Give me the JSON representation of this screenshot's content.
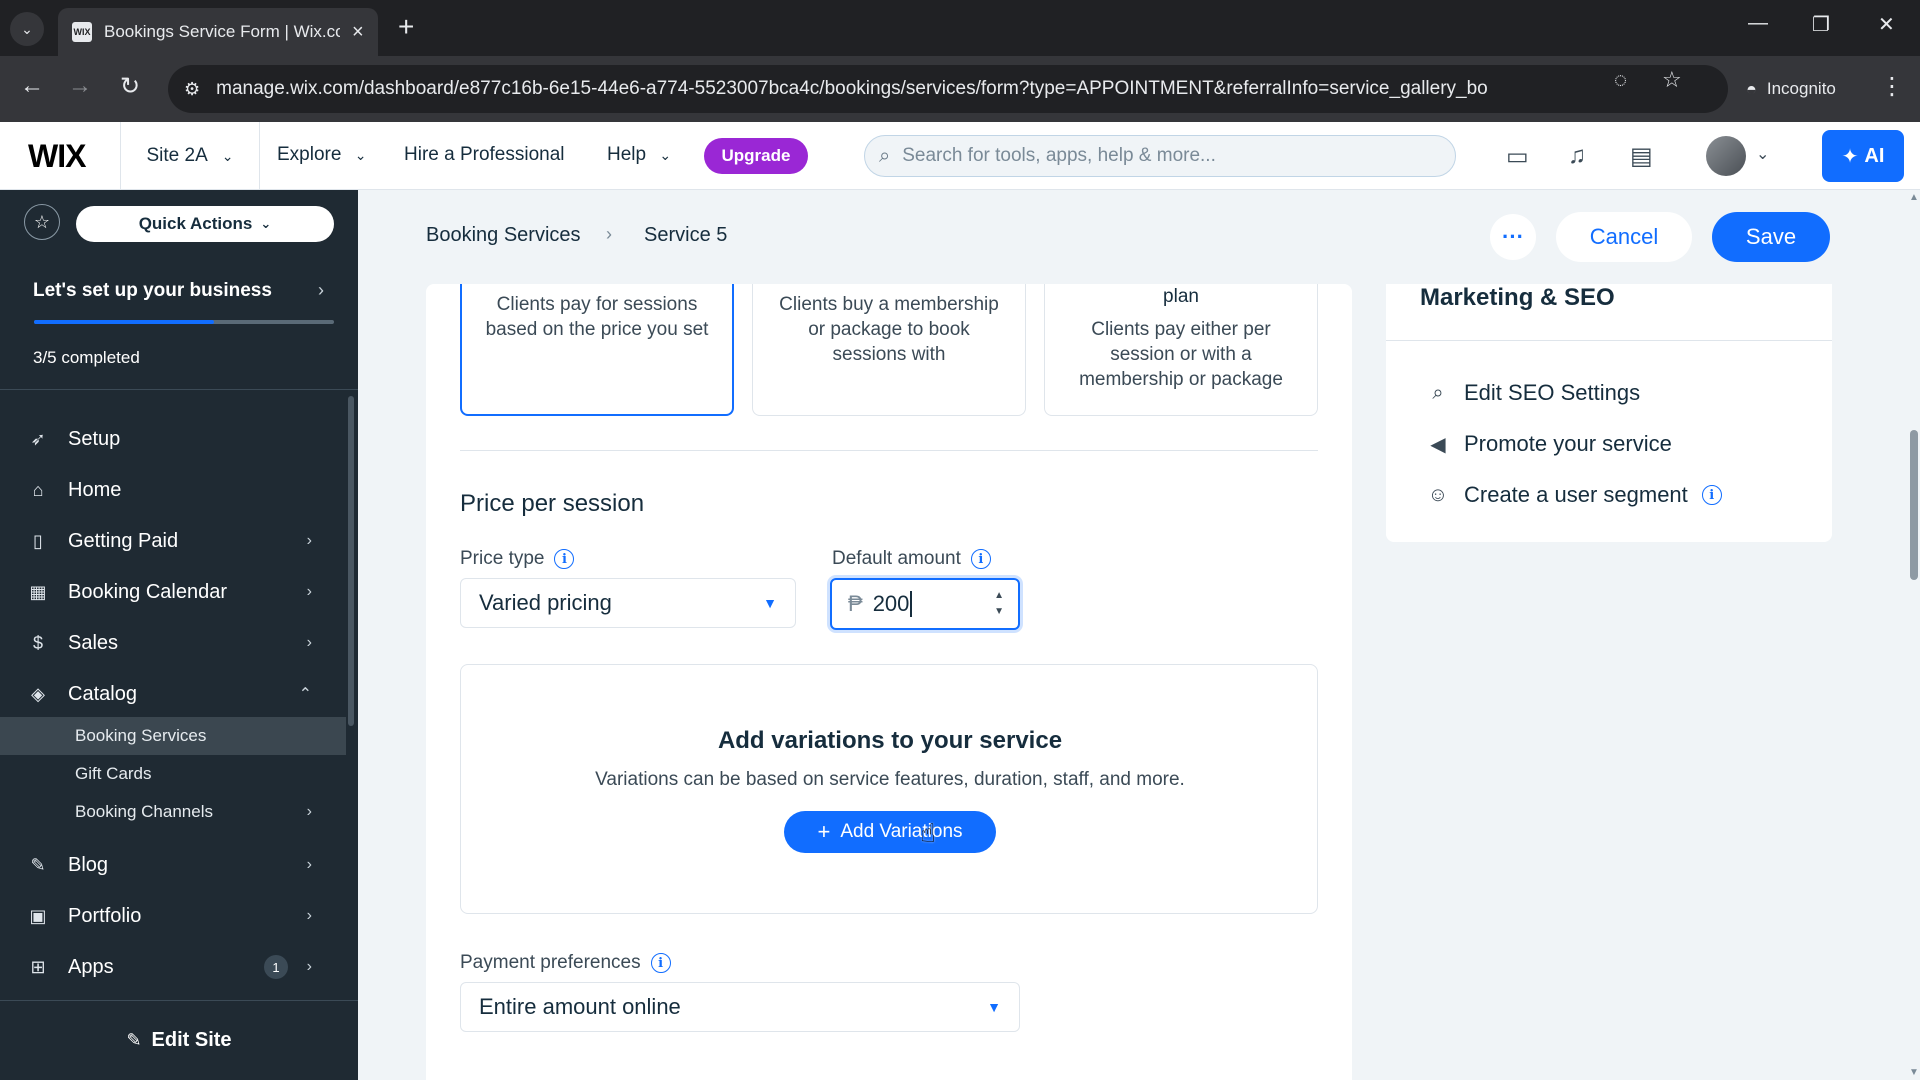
{
  "browser": {
    "tab_title": "Bookings Service Form | Wix.com",
    "favicon_text": "WIX",
    "url": "manage.wix.com/dashboard/e877c16b-6e15-44e6-a774-5523007bca4c/bookings/services/form?type=APPOINTMENT&referralInfo=service_gallery_bo",
    "incognito_label": "Incognito"
  },
  "topbar": {
    "logo": "WIX",
    "site_name": "Site 2A",
    "explore": "Explore",
    "hire": "Hire a Professional",
    "help": "Help",
    "upgrade": "Upgrade",
    "search_placeholder": "Search for tools, apps, help & more...",
    "ai_label": "AI"
  },
  "sidebar": {
    "quick_actions": "Quick Actions",
    "setup_title": "Let's set up your business",
    "setup_count": "3/5 completed",
    "setup_progress": 0.6,
    "items": [
      {
        "label": "Setup",
        "icon": "rocket-icon"
      },
      {
        "label": "Home",
        "icon": "home-icon"
      },
      {
        "label": "Getting Paid",
        "icon": "receipt-icon"
      },
      {
        "label": "Booking Calendar",
        "icon": "calendar-icon"
      },
      {
        "label": "Sales",
        "icon": "dollar-icon"
      },
      {
        "label": "Catalog",
        "icon": "tag-icon"
      }
    ],
    "catalog_sub": [
      "Booking Services",
      "Gift Cards",
      "Booking Channels"
    ],
    "items2": [
      {
        "label": "Blog",
        "icon": "pen-icon"
      },
      {
        "label": "Portfolio",
        "icon": "portfolio-icon"
      },
      {
        "label": "Apps",
        "icon": "apps-icon",
        "badge": "1"
      }
    ],
    "edit_site": "Edit Site"
  },
  "header": {
    "breadcrumb": [
      "Booking Services",
      "Service 5"
    ],
    "cancel": "Cancel",
    "save": "Save"
  },
  "payment_options": [
    {
      "plan": "",
      "desc": "Clients pay for sessions based on the price you set",
      "selected": true
    },
    {
      "plan": "",
      "desc": "Clients buy a membership or package to book sessions with",
      "selected": false
    },
    {
      "plan": "plan",
      "desc": "Clients pay either per session or with a membership or package",
      "selected": false
    }
  ],
  "pricing": {
    "section_title": "Price per session",
    "price_type_label": "Price type",
    "price_type_value": "Varied pricing",
    "default_amount_label": "Default amount",
    "currency_symbol": "₱",
    "default_amount_value": "200"
  },
  "variations": {
    "title": "Add variations to your service",
    "subtitle": "Variations can be based on service features, duration, staff, and more.",
    "button": "Add Variations"
  },
  "payment_pref": {
    "label": "Payment preferences",
    "value": "Entire amount online"
  },
  "marketing": {
    "title": "Marketing & SEO",
    "links": [
      {
        "label": "Edit SEO Settings",
        "icon": "seo-search-icon"
      },
      {
        "label": "Promote your service",
        "icon": "megaphone-icon"
      },
      {
        "label": "Create a user segment",
        "icon": "users-icon"
      }
    ]
  },
  "colors": {
    "accent": "#116dff",
    "upgrade": "#9a27d5",
    "sidebar_bg": "#1f2a33"
  }
}
